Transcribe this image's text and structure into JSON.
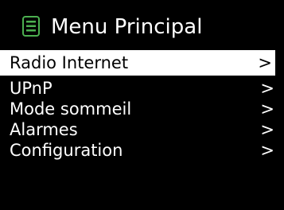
{
  "header": {
    "icon": "menu-list-icon",
    "title": "Menu Principal"
  },
  "menu": {
    "selected_index": 0,
    "items": [
      {
        "label": "Radio Internet",
        "arrow": ">"
      },
      {
        "label": "UPnP",
        "arrow": ">"
      },
      {
        "label": "Mode sommeil",
        "arrow": ">"
      },
      {
        "label": "Alarmes",
        "arrow": ">"
      },
      {
        "label": "Configuration",
        "arrow": ">"
      }
    ]
  },
  "colors": {
    "background": "#000000",
    "text": "#ffffff",
    "accent": "#4caf50",
    "selection_bg": "#ffffff",
    "selection_text": "#000000"
  }
}
